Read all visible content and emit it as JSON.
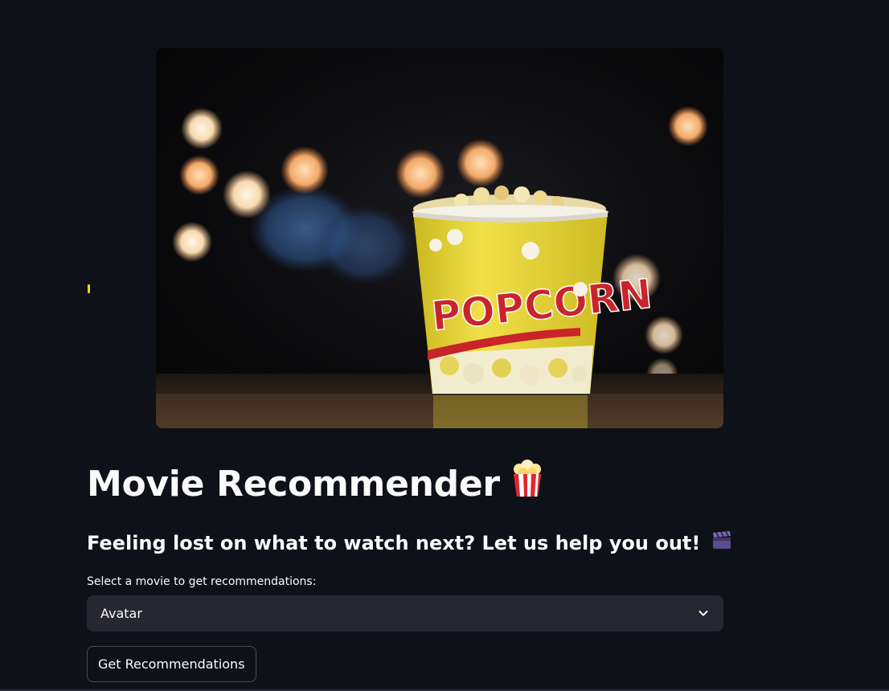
{
  "page": {
    "title": "Movie Recommender",
    "subtitle": "Feeling lost on what to watch next? Let us help you out!",
    "title_emoji": "popcorn-emoji",
    "subtitle_emoji": "clapper-board-emoji"
  },
  "hero_image": {
    "description_icon": "popcorn-bucket-image",
    "bucket_text": "POPCORN"
  },
  "select": {
    "label": "Select a movie to get recommendations:",
    "value": "Avatar"
  },
  "button": {
    "label": "Get Recommendations"
  },
  "colors": {
    "background": "#0e1117",
    "input_bg": "#262730",
    "text": "#fafafa",
    "accent_yellow": "#ffd400"
  }
}
